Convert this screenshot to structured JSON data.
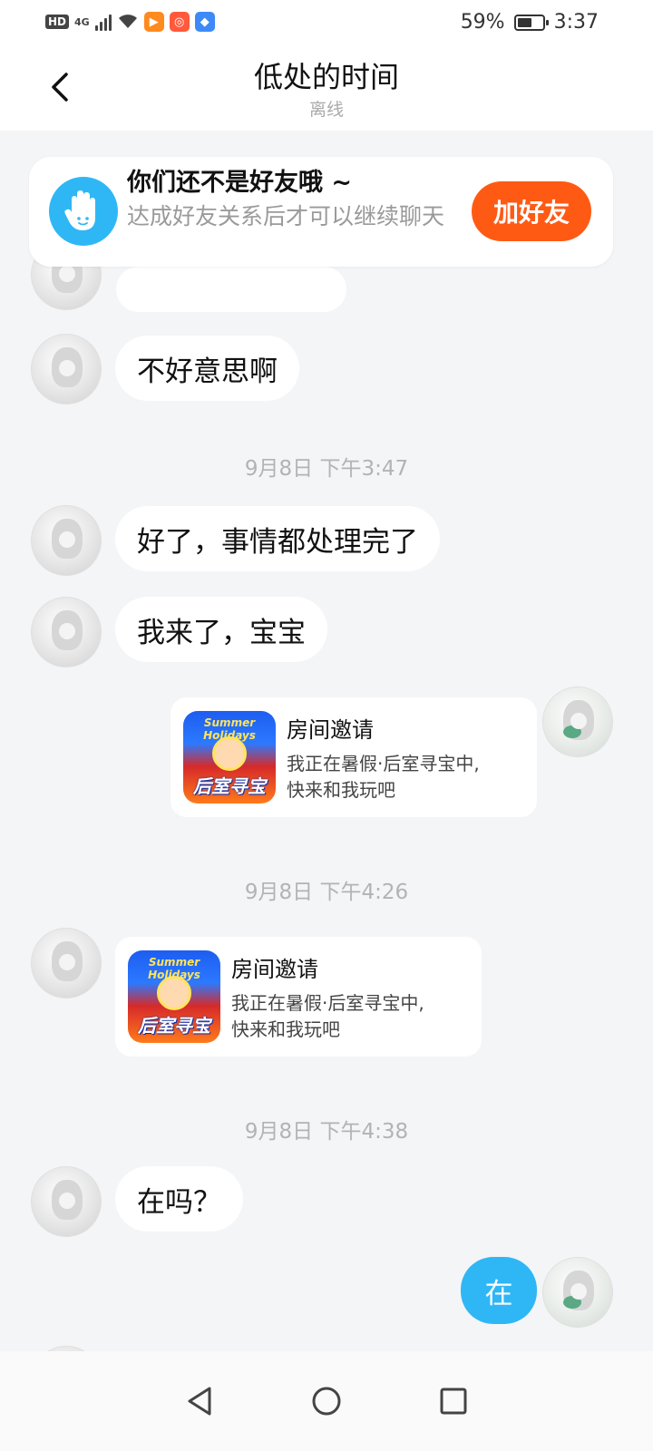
{
  "status_bar": {
    "hd": "HD",
    "network": "4G",
    "battery": "59%",
    "battery_level": 0.59,
    "time": "3:37"
  },
  "header": {
    "title": "低处的时间",
    "subtitle": "离线"
  },
  "banner": {
    "title": "你们还不是好友哦 ~",
    "description": "达成好友关系后才可以继续聊天",
    "button": "加好友"
  },
  "messages": [
    {
      "type": "text",
      "side": "left",
      "text": "不好意思啊"
    },
    {
      "type": "timestamp",
      "text": "9月8日 下午3:47"
    },
    {
      "type": "text",
      "side": "left",
      "text": "好了，事情都处理完了"
    },
    {
      "type": "text",
      "side": "left",
      "text": "我来了，宝宝"
    },
    {
      "type": "card",
      "side": "right",
      "title": "房间邀请",
      "desc1": "我正在暑假·后室寻宝中,",
      "desc2": "快来和我玩吧",
      "thumb_top": "Summer Holidays",
      "thumb_bottom": "后室寻宝"
    },
    {
      "type": "timestamp",
      "text": "9月8日 下午4:26"
    },
    {
      "type": "card",
      "side": "left",
      "title": "房间邀请",
      "desc1": "我正在暑假·后室寻宝中,",
      "desc2": "快来和我玩吧",
      "thumb_top": "Summer Holidays",
      "thumb_bottom": "后室寻宝"
    },
    {
      "type": "timestamp",
      "text": "9月8日 下午4:38"
    },
    {
      "type": "text",
      "side": "left",
      "text": "在吗？"
    },
    {
      "type": "text",
      "side": "right",
      "text": "在"
    }
  ],
  "colors": {
    "accent_blue": "#2fb7f5",
    "add_button": "#ff5a14",
    "background": "#f4f5f7"
  }
}
